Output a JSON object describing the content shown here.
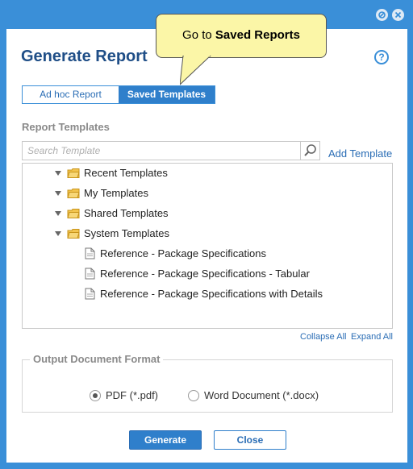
{
  "window": {
    "title_buttons": [
      "restore-icon",
      "close-icon"
    ]
  },
  "dialog": {
    "title": "Generate Report",
    "help_icon": "?"
  },
  "callout": {
    "prefix": "Go to ",
    "emphasis": "Saved Reports"
  },
  "tabs": {
    "adhoc_label": "Ad hoc Report",
    "saved_label": "Saved Templates",
    "selected": "saved"
  },
  "templates": {
    "section_label": "Report Templates",
    "search_placeholder": "Search Template",
    "search_value": "",
    "add_label": "Add Template",
    "folders": [
      {
        "label": "Recent Templates"
      },
      {
        "label": "My Templates"
      },
      {
        "label": "Shared Templates"
      },
      {
        "label": "System Templates"
      }
    ],
    "documents": [
      {
        "label": "Reference - Package Specifications"
      },
      {
        "label": "Reference - Package Specifications - Tabular"
      },
      {
        "label": "Reference - Package Specifications with Details"
      }
    ],
    "collapse_all": "Collapse All",
    "expand_all": "Expand All"
  },
  "output": {
    "legend": "Output Document Format",
    "options": [
      {
        "label": "PDF (*.pdf)",
        "selected": true
      },
      {
        "label": "Word Document (*.docx)",
        "selected": false
      }
    ]
  },
  "actions": {
    "generate_label": "Generate",
    "close_label": "Close"
  },
  "colors": {
    "frame": "#3a8fd8",
    "accent": "#2f7fcb",
    "title": "#1f4e87",
    "callout_bg": "#fbf6a7"
  }
}
